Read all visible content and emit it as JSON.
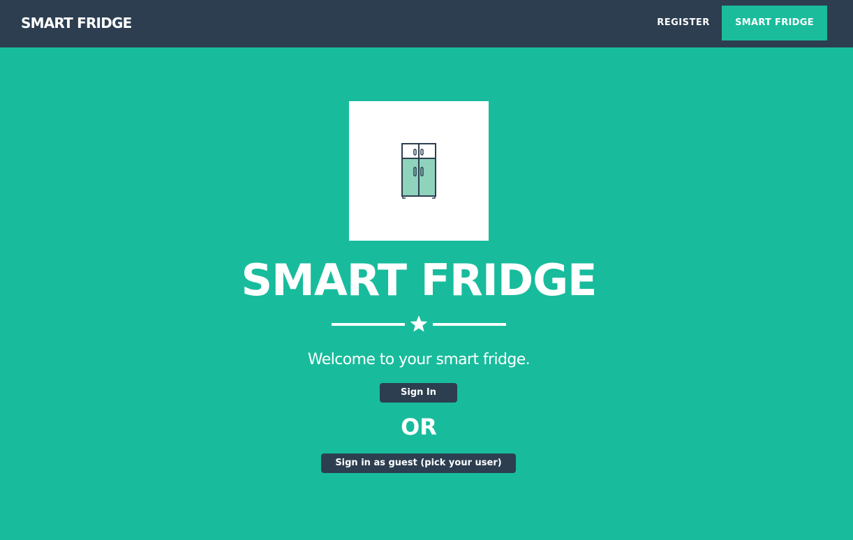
{
  "navbar": {
    "brand": "SMART FRIDGE",
    "links": [
      {
        "label": "REGISTER",
        "active": false
      },
      {
        "label": "SMART FRIDGE",
        "active": true
      }
    ]
  },
  "hero": {
    "logo_icon": "fridge-icon",
    "divider_icon": "star-icon",
    "title": "SMART FRIDGE",
    "subtitle": "Welcome to your smart fridge.",
    "sign_in_label": "Sign In",
    "or_label": "OR",
    "guest_label": "Sign in as guest (pick your user)"
  },
  "colors": {
    "navbar_bg": "#2c3e50",
    "page_bg": "#18bc9c",
    "active_nav_bg": "#1abc9c",
    "button_bg": "#2c3e50",
    "icon_stroke": "#2c3e50",
    "icon_fill": "#8fd3bc"
  }
}
